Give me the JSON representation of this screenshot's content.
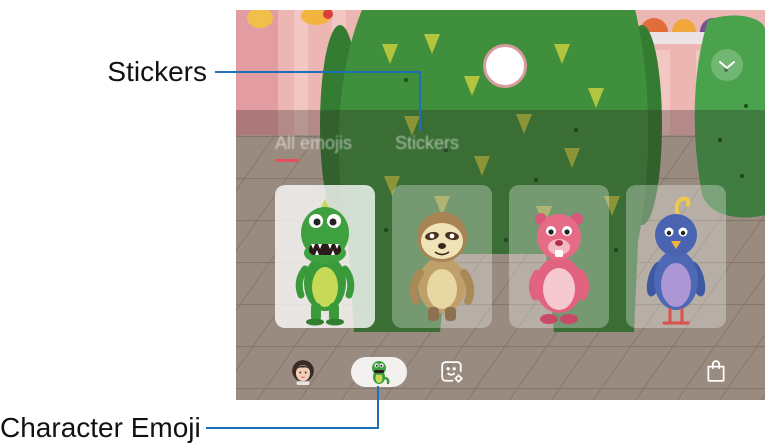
{
  "callouts": {
    "stickers_label": "Stickers",
    "character_emoji_label": "Character Emoji",
    "line_color": "#1d6fb8"
  },
  "screen": {
    "shutter": {
      "icon": "shutter-circle-icon"
    },
    "collapse": {
      "icon": "chevron-down-icon"
    },
    "tabs": [
      {
        "label": "All emojis",
        "active": true
      },
      {
        "label": "Stickers",
        "active": false
      }
    ],
    "tab_indicator_color": "#e4505c",
    "emoji_cards": [
      {
        "icon": "dinosaur-emoji-icon",
        "selected": true
      },
      {
        "icon": "sloth-emoji-icon",
        "selected": false
      },
      {
        "icon": "beaver-emoji-icon",
        "selected": false
      },
      {
        "icon": "bird-emoji-icon",
        "selected": false
      }
    ],
    "bottom_bar": [
      {
        "icon": "my-emoji-avatar-icon",
        "selected": false
      },
      {
        "icon": "character-emoji-icon",
        "selected": true
      },
      {
        "icon": "sticker-settings-icon",
        "selected": false
      },
      {
        "icon": "shopping-bag-icon",
        "selected": false
      }
    ]
  }
}
